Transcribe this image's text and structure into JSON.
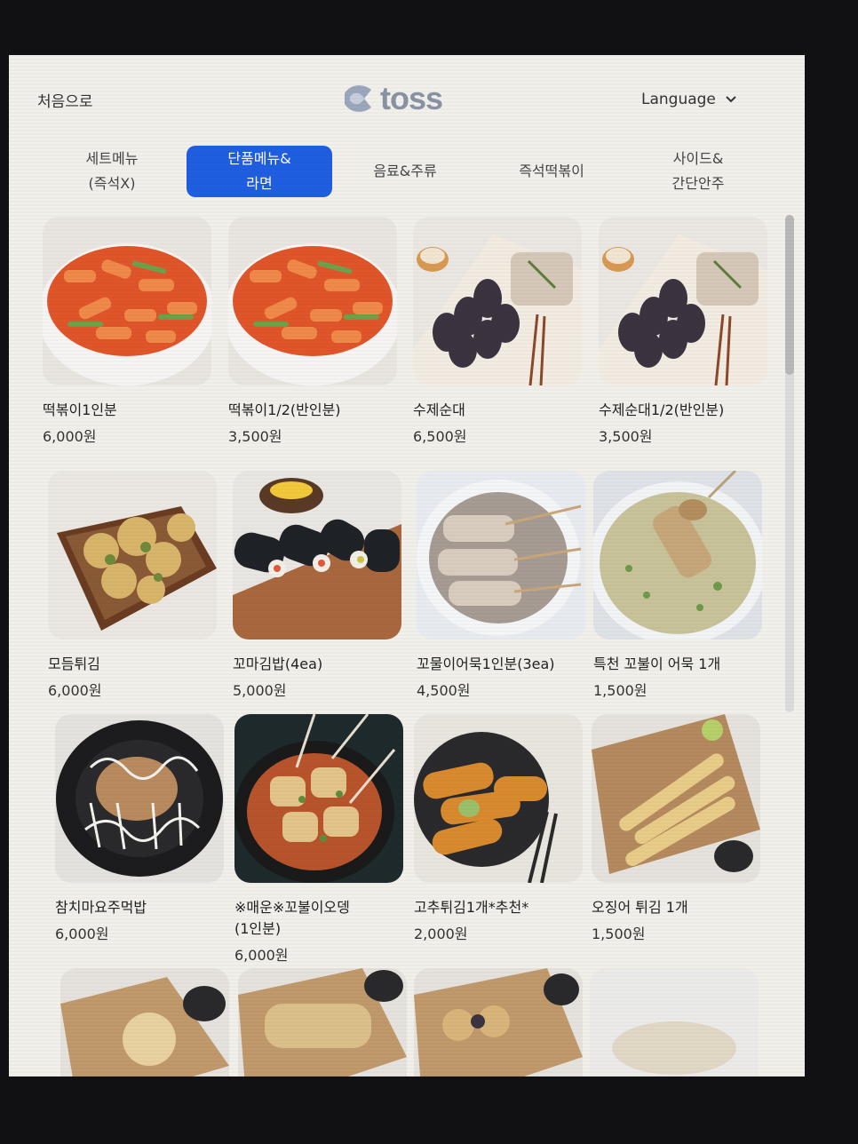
{
  "header": {
    "home_label": "처음으로",
    "logo_text": "toss",
    "language_label": "Language"
  },
  "tabs": [
    {
      "label": "세트메뉴\n(즉석X)"
    },
    {
      "label": "단품메뉴&\n라면"
    },
    {
      "label": "음료&주류"
    },
    {
      "label": "즉석떡볶이"
    },
    {
      "label": "사이드&\n간단안주"
    }
  ],
  "active_tab_index": 1,
  "colors": {
    "accent": "#1f5ee0",
    "background": "#f1f0ea"
  },
  "menu": [
    {
      "name": "떡볶이1인분",
      "price": "6,000원",
      "image": "tteokbokki"
    },
    {
      "name": "떡볶이1/2(반인분)",
      "price": "3,500원",
      "image": "tteokbokki"
    },
    {
      "name": "수제순대",
      "price": "6,500원",
      "image": "sundae"
    },
    {
      "name": "수제순대1/2(반인분)",
      "price": "3,500원",
      "image": "sundae"
    },
    {
      "name": "모듬튀김",
      "price": "6,000원",
      "image": "mixed-fried"
    },
    {
      "name": "꼬마김밥(4ea)",
      "price": "5,000원",
      "image": "gimbap"
    },
    {
      "name": "꼬물이어묵1인분(3ea)",
      "price": "4,500원",
      "image": "fishcake-skewers"
    },
    {
      "name": "특천 꼬불이 어묵 1개",
      "price": "1,500원",
      "image": "fishcake-soup"
    },
    {
      "name": "참치마요주먹밥",
      "price": "6,000원",
      "image": "tuna-rice"
    },
    {
      "name": "※매운※꼬불이오뎅\n(1인분)",
      "price": "6,000원",
      "image": "spicy-oden"
    },
    {
      "name": "고추튀김1개*추천*",
      "price": "2,000원",
      "image": "pepper-fried"
    },
    {
      "name": "오징어 튀김 1개",
      "price": "1,500원",
      "image": "squid-fried"
    }
  ]
}
